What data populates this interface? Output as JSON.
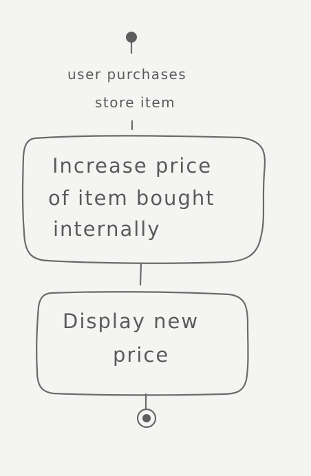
{
  "diagram": {
    "trigger_line1": "user purchases",
    "trigger_line2": "store item",
    "step1": {
      "line1": "Increase price",
      "line2": "of item bought",
      "line3": "internally"
    },
    "step2": {
      "line1": "Display new",
      "line2": "price"
    }
  }
}
